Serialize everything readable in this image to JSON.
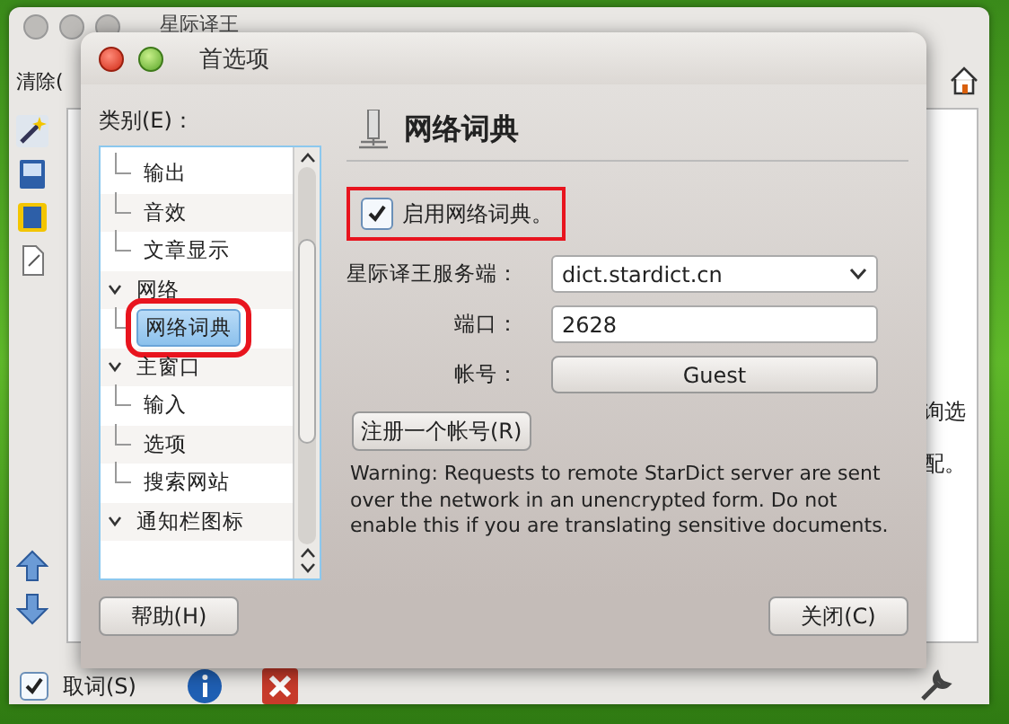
{
  "main_window": {
    "title": "星际译王",
    "clear_button": "清除(",
    "side_texts": [
      "询选",
      "配。"
    ],
    "pick_words": {
      "label": "取词(S)",
      "checked": true
    }
  },
  "dialog": {
    "title": "首选项",
    "category_label": "类别(E)：",
    "tree": [
      {
        "expanded": true,
        "children": [
          {
            "label": "输出",
            "selected": false
          },
          {
            "label": "音效",
            "selected": false
          },
          {
            "label": "文章显示",
            "selected": false
          }
        ]
      },
      {
        "label": "网络",
        "expanded": true,
        "children": [
          {
            "label": "网络词典",
            "selected": true,
            "highlighted": true
          }
        ]
      },
      {
        "label": "主窗口",
        "expanded": true,
        "children": [
          {
            "label": "输入",
            "selected": false
          },
          {
            "label": "选项",
            "selected": false
          },
          {
            "label": "搜索网站",
            "selected": false
          }
        ]
      },
      {
        "label": "通知栏图标",
        "expanded": true
      }
    ],
    "page_title": "网络词典",
    "enable": {
      "label": "启用网络词典。",
      "checked": true,
      "highlighted": true
    },
    "fields": [
      {
        "label": "星际译王服务端：",
        "kind": "combo",
        "value": "dict.stardict.cn"
      },
      {
        "label": "端口：",
        "kind": "input",
        "value": "2628"
      },
      {
        "label": "帐号：",
        "kind": "button",
        "value": "Guest"
      }
    ],
    "register_button": "注册一个帐号(R)",
    "warning": "Warning: Requests to remote StarDict server are sent over the network in an unencrypted form. Do not enable this if you are translating sensitive documents.",
    "help_button": "帮助(H)",
    "close_button": "关闭(C)"
  }
}
